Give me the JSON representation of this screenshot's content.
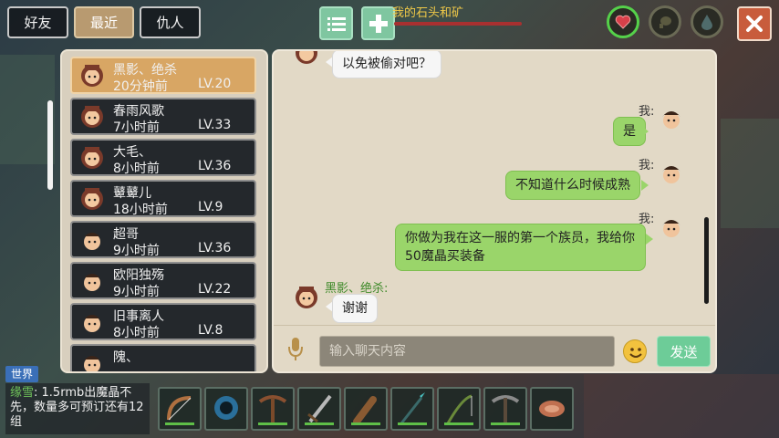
{
  "tabs": [
    {
      "label": "好友"
    },
    {
      "label": "最近"
    },
    {
      "label": "仇人"
    }
  ],
  "quest": {
    "text": "我的石头和矿"
  },
  "friends": [
    {
      "name": "黑影、绝杀",
      "time": "20分钟前",
      "level": "LV.20",
      "gender": "female"
    },
    {
      "name": "春雨风歌",
      "time": "7小时前",
      "level": "LV.33",
      "gender": "female"
    },
    {
      "name": "大毛、",
      "time": "8小时前",
      "level": "LV.36",
      "gender": "female"
    },
    {
      "name": "鼙鼙儿",
      "time": "18小时前",
      "level": "LV.9",
      "gender": "female"
    },
    {
      "name": "超哥",
      "time": "9小时前",
      "level": "LV.36",
      "gender": "male"
    },
    {
      "name": "欧阳独殇",
      "time": "9小时前",
      "level": "LV.22",
      "gender": "male"
    },
    {
      "name": "旧事离人",
      "time": "8小时前",
      "level": "LV.8",
      "gender": "male"
    },
    {
      "name": "隗、",
      "time": "",
      "level": "",
      "gender": "male"
    }
  ],
  "chat": {
    "me_label": "我:",
    "messages": [
      {
        "from": "other",
        "text": "以免被偷对吧？"
      },
      {
        "from": "me",
        "text": "是"
      },
      {
        "from": "me",
        "text": "不知道什么时候成熟"
      },
      {
        "from": "me",
        "text": "你做为我在这一服的第一个族员，我给你50魔晶买装备"
      },
      {
        "from": "other",
        "sender": "黑影、绝杀:",
        "text": "谢谢"
      }
    ],
    "input_placeholder": "输入聊天内容",
    "send_label": "发送"
  },
  "world": {
    "tag": "世界",
    "sender": "缘雪",
    "message": ": 1.5rmb出魔晶不先，数量多可预订还有12组"
  },
  "hotbar": [
    "bow-icon",
    "orb-icon",
    "pickaxe-icon",
    "sword-icon",
    "club-icon",
    "spear-icon",
    "fishing-rod-icon",
    "pickaxe-icon",
    "meat-icon"
  ],
  "colors": {
    "accent_green": "#9ad56a",
    "send_button": "#6dcc98",
    "selected_friend": "#d8a664",
    "close_button": "#c85c3c"
  }
}
